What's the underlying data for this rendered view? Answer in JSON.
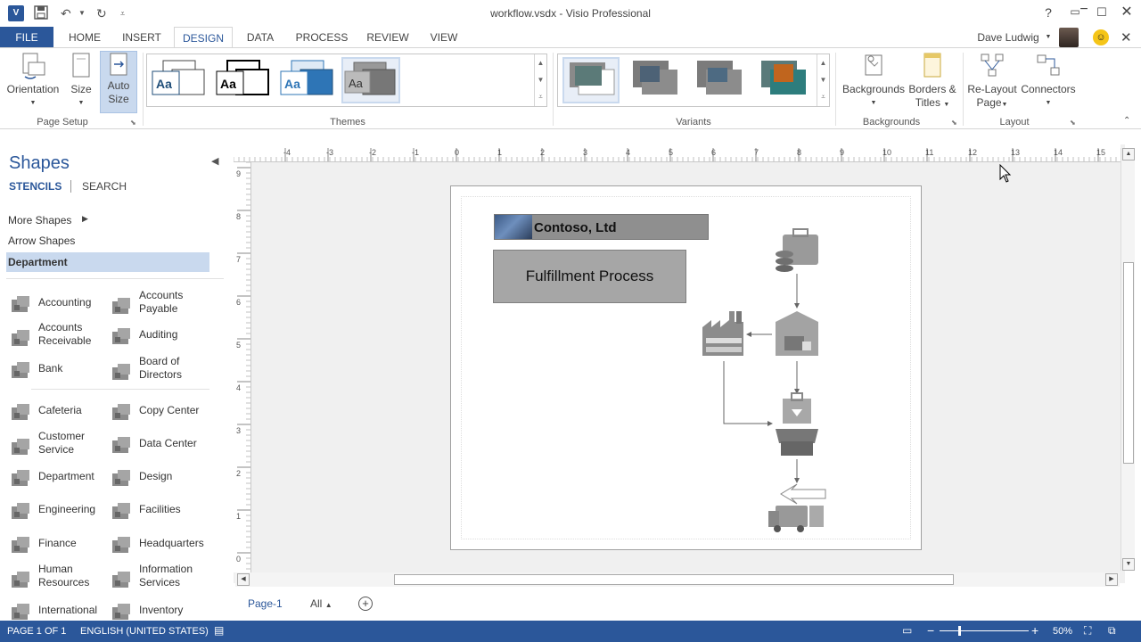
{
  "window": {
    "title": "workflow.vsdx - Visio Professional",
    "help": "?"
  },
  "tabs": {
    "file": "FILE",
    "home": "HOME",
    "insert": "INSERT",
    "design": "DESIGN",
    "data": "DATA",
    "process": "PROCESS",
    "review": "REVIEW",
    "view": "VIEW"
  },
  "user": {
    "name": "Dave Ludwig"
  },
  "ribbon": {
    "page_setup": {
      "orientation": "Orientation",
      "size": "Size",
      "auto_size_1": "Auto",
      "auto_size_2": "Size",
      "group": "Page Setup"
    },
    "themes": {
      "group": "Themes",
      "thumb_text": "Aa"
    },
    "variants": {
      "group": "Variants"
    },
    "backgrounds": {
      "backgrounds": "Backgrounds",
      "borders_1": "Borders &",
      "borders_2": "Titles",
      "group": "Backgrounds"
    },
    "layout": {
      "relayout_1": "Re-Layout",
      "relayout_2": "Page",
      "connectors": "Connectors",
      "group": "Layout"
    }
  },
  "shapes_pane": {
    "title": "Shapes",
    "stencils_tab": "STENCILS",
    "search_tab": "SEARCH",
    "more_shapes": "More Shapes",
    "arrow_shapes": "Arrow Shapes",
    "department": "Department",
    "items": [
      {
        "label1": "Accounting",
        "label2": ""
      },
      {
        "label1": "Accounts",
        "label2": "Payable"
      },
      {
        "label1": "Accounts",
        "label2": "Receivable"
      },
      {
        "label1": "Auditing",
        "label2": ""
      },
      {
        "label1": "Bank",
        "label2": ""
      },
      {
        "label1": "Board of",
        "label2": "Directors"
      },
      {
        "label1": "Cafeteria",
        "label2": ""
      },
      {
        "label1": "Copy Center",
        "label2": ""
      },
      {
        "label1": "Customer",
        "label2": "Service"
      },
      {
        "label1": "Data Center",
        "label2": ""
      },
      {
        "label1": "Department",
        "label2": ""
      },
      {
        "label1": "Design",
        "label2": ""
      },
      {
        "label1": "Engineering",
        "label2": ""
      },
      {
        "label1": "Facilities",
        "label2": ""
      },
      {
        "label1": "Finance",
        "label2": ""
      },
      {
        "label1": "Headquarters",
        "label2": ""
      },
      {
        "label1": "Human",
        "label2": "Resources"
      },
      {
        "label1": "Information",
        "label2": "Services"
      },
      {
        "label1": "International",
        "label2": ""
      },
      {
        "label1": "Inventory",
        "label2": ""
      }
    ]
  },
  "ruler": {
    "h_ticks": [
      "-4",
      "-3",
      "-2",
      "-1",
      "0",
      "1",
      "2",
      "3",
      "4",
      "5",
      "6",
      "7",
      "8",
      "9",
      "10",
      "11",
      "12",
      "13",
      "14",
      "15"
    ],
    "v_ticks": [
      "9",
      "8",
      "7",
      "6",
      "5",
      "4",
      "3",
      "2",
      "1",
      "0"
    ]
  },
  "drawing": {
    "company": "Contoso, Ltd",
    "process_title": "Fulfillment Process"
  },
  "page_tabs": {
    "page1": "Page-1",
    "all": "All"
  },
  "status": {
    "page": "PAGE 1 OF 1",
    "language": "ENGLISH (UNITED STATES)",
    "zoom": "50%"
  },
  "colors": {
    "accent": "#2b579a",
    "selected": "#c9d9ee"
  }
}
